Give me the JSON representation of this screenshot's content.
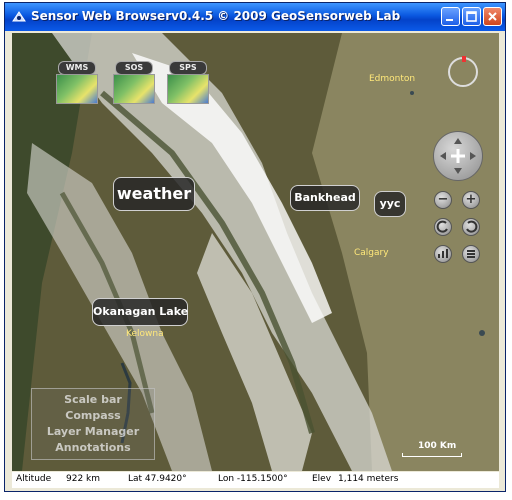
{
  "window": {
    "title": "Sensor Web Browserv0.4.5 © 2009 GeoSensorweb Lab",
    "controls": [
      "minimize-icon",
      "maximize-icon",
      "close-icon"
    ]
  },
  "services": [
    {
      "label": "WMS"
    },
    {
      "label": "SOS"
    },
    {
      "label": "SPS"
    }
  ],
  "map_labels": {
    "weather": "weather",
    "bankhead": "Bankhead",
    "yyc": "yyc",
    "okanagan": "Okanagan Lake"
  },
  "cities": {
    "edmonton": "Edmonton",
    "calgary": "Calgary",
    "kelowna": "Kelowna"
  },
  "layer_menu": {
    "items": [
      "Scale bar",
      "Compass",
      "Layer Manager",
      "Annotations"
    ]
  },
  "scale": {
    "text": "100 Km"
  },
  "status": {
    "altitude_label": "Altitude",
    "altitude_value": "922 km",
    "lat": "Lat 47.9420°",
    "lon": "Lon -115.1500°",
    "elev_label": "Elev",
    "elev_value": "1,114 meters"
  },
  "colors": {
    "titlebar": "#0a58e0",
    "terrain": "#6b6646",
    "city_label": "#ffe87a"
  }
}
